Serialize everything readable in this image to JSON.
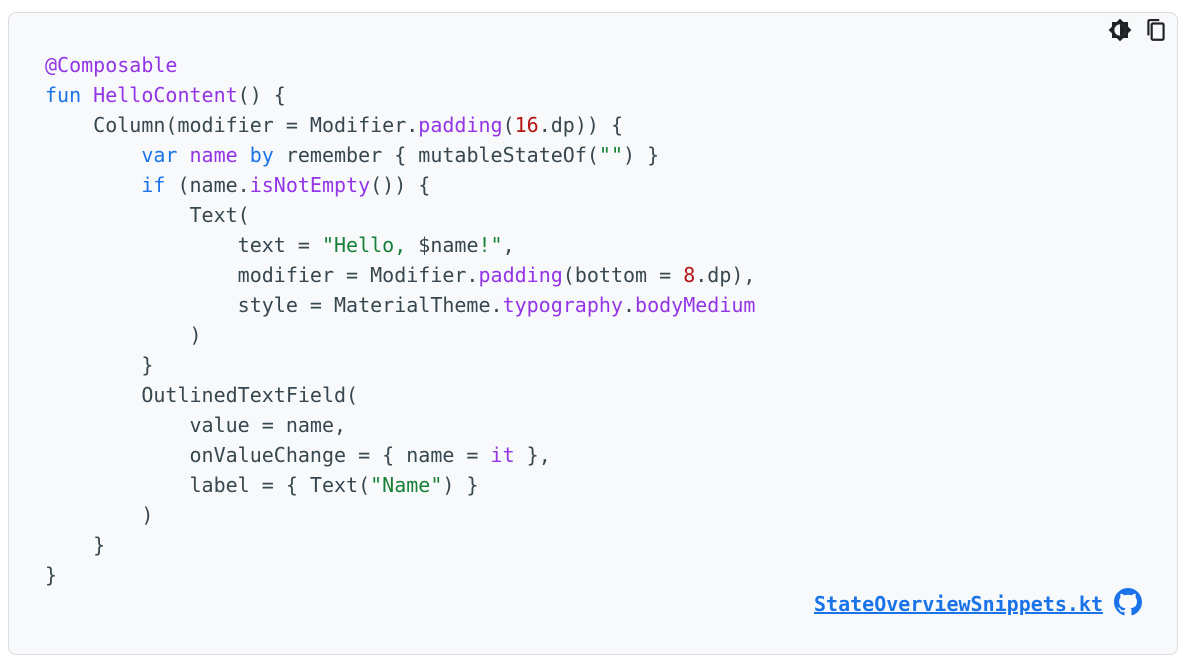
{
  "toolbar": {
    "theme_toggle_icon": "brightness-icon",
    "copy_icon": "copy-icon"
  },
  "code": {
    "lines": [
      [
        {
          "t": "@Composable",
          "c": "fn"
        }
      ],
      [
        {
          "t": "fun",
          "c": "kw"
        },
        {
          "t": " ",
          "c": "pl"
        },
        {
          "t": "HelloContent",
          "c": "fn"
        },
        {
          "t": "() {",
          "c": "pl"
        }
      ],
      [
        {
          "t": "    Column(modifier = Modifier.",
          "c": "pl"
        },
        {
          "t": "padding",
          "c": "fn"
        },
        {
          "t": "(",
          "c": "pl"
        },
        {
          "t": "16",
          "c": "num"
        },
        {
          "t": ".dp)) {",
          "c": "pl"
        }
      ],
      [
        {
          "t": "        ",
          "c": "pl"
        },
        {
          "t": "var",
          "c": "kw"
        },
        {
          "t": " ",
          "c": "pl"
        },
        {
          "t": "name",
          "c": "fn"
        },
        {
          "t": " ",
          "c": "pl"
        },
        {
          "t": "by",
          "c": "kw"
        },
        {
          "t": " remember { mutableStateOf(",
          "c": "pl"
        },
        {
          "t": "\"\"",
          "c": "str"
        },
        {
          "t": ") }",
          "c": "pl"
        }
      ],
      [
        {
          "t": "        ",
          "c": "pl"
        },
        {
          "t": "if",
          "c": "kw"
        },
        {
          "t": " (name.",
          "c": "pl"
        },
        {
          "t": "isNotEmpty",
          "c": "fn"
        },
        {
          "t": "()) {",
          "c": "pl"
        }
      ],
      [
        {
          "t": "            Text(",
          "c": "pl"
        }
      ],
      [
        {
          "t": "                text = ",
          "c": "pl"
        },
        {
          "t": "\"Hello, ",
          "c": "str"
        },
        {
          "t": "$",
          "c": "pl"
        },
        {
          "t": "name",
          "c": "pl"
        },
        {
          "t": "!\"",
          "c": "str"
        },
        {
          "t": ",",
          "c": "pl"
        }
      ],
      [
        {
          "t": "                modifier = Modifier.",
          "c": "pl"
        },
        {
          "t": "padding",
          "c": "fn"
        },
        {
          "t": "(bottom = ",
          "c": "pl"
        },
        {
          "t": "8",
          "c": "num"
        },
        {
          "t": ".dp),",
          "c": "pl"
        }
      ],
      [
        {
          "t": "                style = MaterialTheme.",
          "c": "pl"
        },
        {
          "t": "typography",
          "c": "fn"
        },
        {
          "t": ".",
          "c": "pl"
        },
        {
          "t": "bodyMedium",
          "c": "fn"
        }
      ],
      [
        {
          "t": "            )",
          "c": "pl"
        }
      ],
      [
        {
          "t": "        }",
          "c": "pl"
        }
      ],
      [
        {
          "t": "        OutlinedTextField(",
          "c": "pl"
        }
      ],
      [
        {
          "t": "            value = name,",
          "c": "pl"
        }
      ],
      [
        {
          "t": "            onValueChange = { name = ",
          "c": "pl"
        },
        {
          "t": "it",
          "c": "fn"
        },
        {
          "t": " },",
          "c": "pl"
        }
      ],
      [
        {
          "t": "            label = { Text(",
          "c": "pl"
        },
        {
          "t": "\"Name\"",
          "c": "str"
        },
        {
          "t": ") }",
          "c": "pl"
        }
      ],
      [
        {
          "t": "        )",
          "c": "pl"
        }
      ],
      [
        {
          "t": "    }",
          "c": "pl"
        }
      ],
      [
        {
          "t": "}",
          "c": "pl"
        }
      ]
    ]
  },
  "footer": {
    "file_link": "StateOverviewSnippets.kt",
    "github_icon": "github-icon"
  },
  "colors": {
    "background": "#f8f9fa",
    "border": "#dadce0",
    "keyword": "#1a73e8",
    "function": "#9334e6",
    "string": "#188038",
    "number": "#b31412",
    "plain": "#37474f",
    "link": "#1a73e8"
  }
}
